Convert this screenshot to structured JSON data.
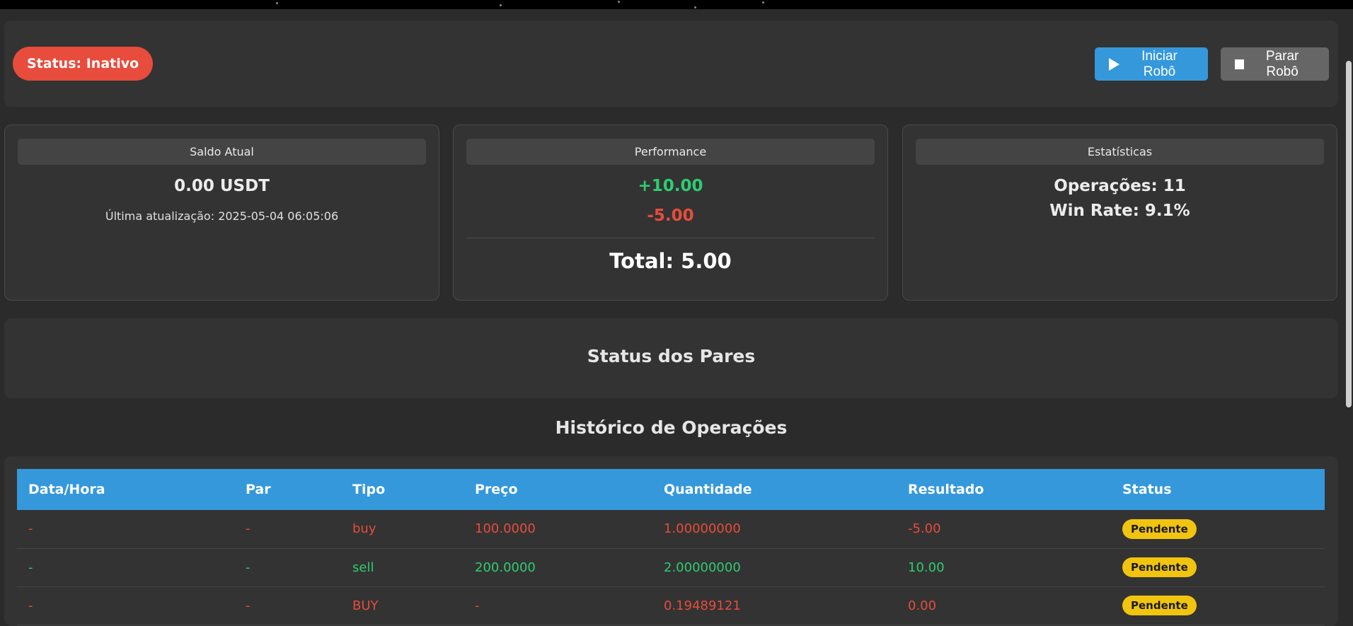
{
  "header": {
    "status_label": "Status: Inativo",
    "start_button": "Iniciar Robô",
    "stop_button": "Parar Robô"
  },
  "cards": {
    "balance": {
      "title": "Saldo Atual",
      "value": "0.00 USDT",
      "updated": "Última atualização: 2025-05-04 06:05:06"
    },
    "performance": {
      "title": "Performance",
      "gain": "+10.00",
      "loss": "-5.00",
      "total": "Total: 5.00"
    },
    "stats": {
      "title": "Estatísticas",
      "operations": "Operações: 11",
      "win_rate": "Win Rate: 9.1%"
    }
  },
  "pairs": {
    "title": "Status dos Pares"
  },
  "history": {
    "title": "Histórico de Operações",
    "columns": [
      "Data/Hora",
      "Par",
      "Tipo",
      "Preço",
      "Quantidade",
      "Resultado",
      "Status"
    ],
    "rows": [
      [
        "-",
        "-",
        "buy",
        "100.0000",
        "1.00000000",
        "-5.00",
        "Pendente"
      ],
      [
        "-",
        "-",
        "sell",
        "200.0000",
        "2.00000000",
        "10.00",
        "Pendente"
      ],
      [
        "-",
        "-",
        "BUY",
        "-",
        "0.19489121",
        "0.00",
        "Pendente"
      ]
    ]
  },
  "colors": {
    "accent": "#3498db",
    "danger": "#e74c3c",
    "success": "#2ecc71",
    "warning": "#f1c40f"
  },
  "icons": {
    "start": "play-icon",
    "stop": "stop-icon"
  }
}
